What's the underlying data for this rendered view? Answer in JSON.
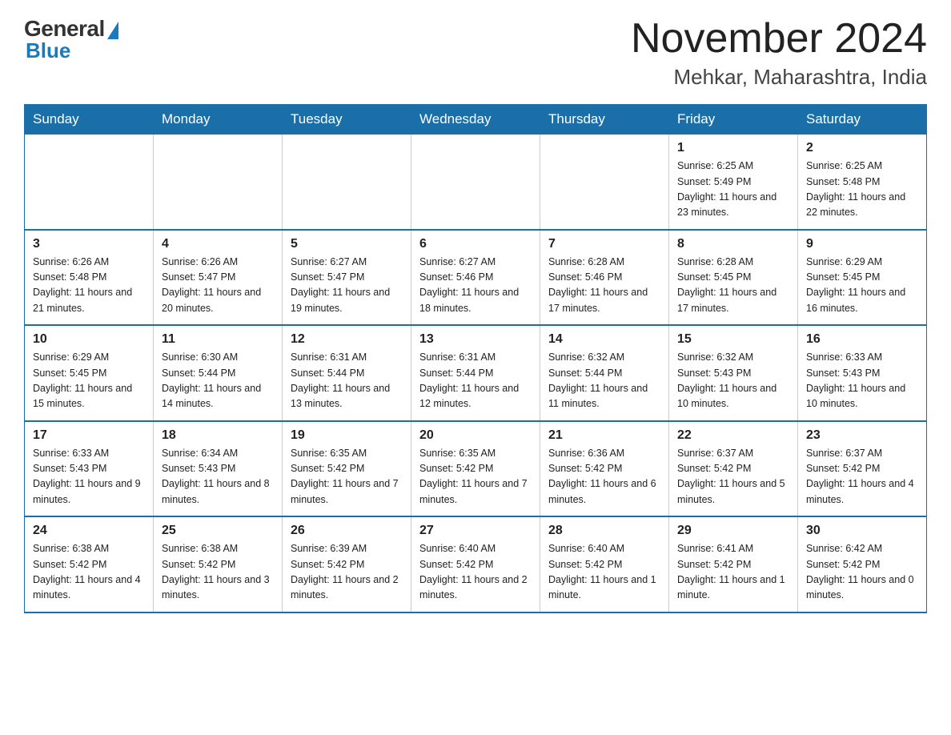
{
  "header": {
    "logo": {
      "general": "General",
      "blue": "Blue"
    },
    "title": "November 2024",
    "subtitle": "Mehkar, Maharashtra, India"
  },
  "weekdays": [
    "Sunday",
    "Monday",
    "Tuesday",
    "Wednesday",
    "Thursday",
    "Friday",
    "Saturday"
  ],
  "weeks": [
    [
      {
        "day": "",
        "info": ""
      },
      {
        "day": "",
        "info": ""
      },
      {
        "day": "",
        "info": ""
      },
      {
        "day": "",
        "info": ""
      },
      {
        "day": "",
        "info": ""
      },
      {
        "day": "1",
        "info": "Sunrise: 6:25 AM\nSunset: 5:49 PM\nDaylight: 11 hours and 23 minutes."
      },
      {
        "day": "2",
        "info": "Sunrise: 6:25 AM\nSunset: 5:48 PM\nDaylight: 11 hours and 22 minutes."
      }
    ],
    [
      {
        "day": "3",
        "info": "Sunrise: 6:26 AM\nSunset: 5:48 PM\nDaylight: 11 hours and 21 minutes."
      },
      {
        "day": "4",
        "info": "Sunrise: 6:26 AM\nSunset: 5:47 PM\nDaylight: 11 hours and 20 minutes."
      },
      {
        "day": "5",
        "info": "Sunrise: 6:27 AM\nSunset: 5:47 PM\nDaylight: 11 hours and 19 minutes."
      },
      {
        "day": "6",
        "info": "Sunrise: 6:27 AM\nSunset: 5:46 PM\nDaylight: 11 hours and 18 minutes."
      },
      {
        "day": "7",
        "info": "Sunrise: 6:28 AM\nSunset: 5:46 PM\nDaylight: 11 hours and 17 minutes."
      },
      {
        "day": "8",
        "info": "Sunrise: 6:28 AM\nSunset: 5:45 PM\nDaylight: 11 hours and 17 minutes."
      },
      {
        "day": "9",
        "info": "Sunrise: 6:29 AM\nSunset: 5:45 PM\nDaylight: 11 hours and 16 minutes."
      }
    ],
    [
      {
        "day": "10",
        "info": "Sunrise: 6:29 AM\nSunset: 5:45 PM\nDaylight: 11 hours and 15 minutes."
      },
      {
        "day": "11",
        "info": "Sunrise: 6:30 AM\nSunset: 5:44 PM\nDaylight: 11 hours and 14 minutes."
      },
      {
        "day": "12",
        "info": "Sunrise: 6:31 AM\nSunset: 5:44 PM\nDaylight: 11 hours and 13 minutes."
      },
      {
        "day": "13",
        "info": "Sunrise: 6:31 AM\nSunset: 5:44 PM\nDaylight: 11 hours and 12 minutes."
      },
      {
        "day": "14",
        "info": "Sunrise: 6:32 AM\nSunset: 5:44 PM\nDaylight: 11 hours and 11 minutes."
      },
      {
        "day": "15",
        "info": "Sunrise: 6:32 AM\nSunset: 5:43 PM\nDaylight: 11 hours and 10 minutes."
      },
      {
        "day": "16",
        "info": "Sunrise: 6:33 AM\nSunset: 5:43 PM\nDaylight: 11 hours and 10 minutes."
      }
    ],
    [
      {
        "day": "17",
        "info": "Sunrise: 6:33 AM\nSunset: 5:43 PM\nDaylight: 11 hours and 9 minutes."
      },
      {
        "day": "18",
        "info": "Sunrise: 6:34 AM\nSunset: 5:43 PM\nDaylight: 11 hours and 8 minutes."
      },
      {
        "day": "19",
        "info": "Sunrise: 6:35 AM\nSunset: 5:42 PM\nDaylight: 11 hours and 7 minutes."
      },
      {
        "day": "20",
        "info": "Sunrise: 6:35 AM\nSunset: 5:42 PM\nDaylight: 11 hours and 7 minutes."
      },
      {
        "day": "21",
        "info": "Sunrise: 6:36 AM\nSunset: 5:42 PM\nDaylight: 11 hours and 6 minutes."
      },
      {
        "day": "22",
        "info": "Sunrise: 6:37 AM\nSunset: 5:42 PM\nDaylight: 11 hours and 5 minutes."
      },
      {
        "day": "23",
        "info": "Sunrise: 6:37 AM\nSunset: 5:42 PM\nDaylight: 11 hours and 4 minutes."
      }
    ],
    [
      {
        "day": "24",
        "info": "Sunrise: 6:38 AM\nSunset: 5:42 PM\nDaylight: 11 hours and 4 minutes."
      },
      {
        "day": "25",
        "info": "Sunrise: 6:38 AM\nSunset: 5:42 PM\nDaylight: 11 hours and 3 minutes."
      },
      {
        "day": "26",
        "info": "Sunrise: 6:39 AM\nSunset: 5:42 PM\nDaylight: 11 hours and 2 minutes."
      },
      {
        "day": "27",
        "info": "Sunrise: 6:40 AM\nSunset: 5:42 PM\nDaylight: 11 hours and 2 minutes."
      },
      {
        "day": "28",
        "info": "Sunrise: 6:40 AM\nSunset: 5:42 PM\nDaylight: 11 hours and 1 minute."
      },
      {
        "day": "29",
        "info": "Sunrise: 6:41 AM\nSunset: 5:42 PM\nDaylight: 11 hours and 1 minute."
      },
      {
        "day": "30",
        "info": "Sunrise: 6:42 AM\nSunset: 5:42 PM\nDaylight: 11 hours and 0 minutes."
      }
    ]
  ]
}
